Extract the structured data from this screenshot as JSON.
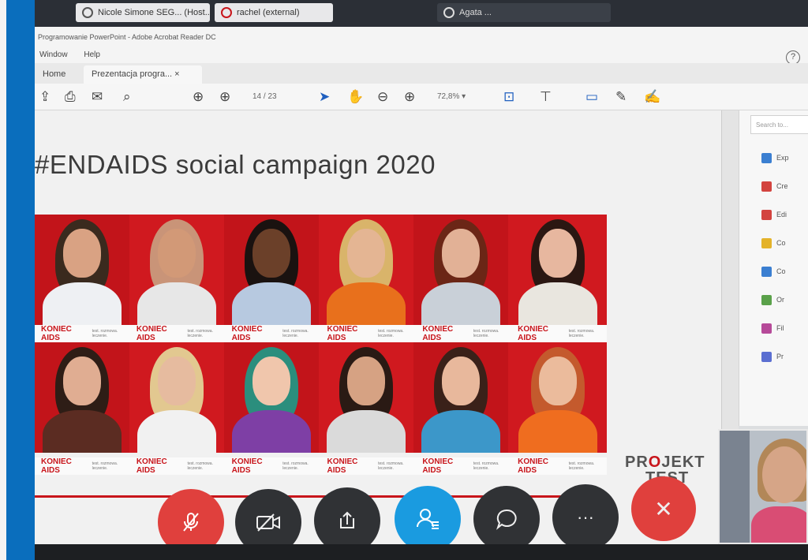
{
  "taskbar": {
    "tab1": "Nicole Simone SEG... (Host...)",
    "tab2": "rachel (external)",
    "tab3": "Agata ..."
  },
  "window": {
    "title": "Programowanie PowerPoint - Adobe Acrobat Reader DC",
    "menu": [
      "Window",
      "Help"
    ],
    "tabs": [
      "Home",
      "Prezentacja progra... ×"
    ],
    "page_indicator": "14 / 23",
    "zoom": "72,8%  ▾"
  },
  "slide": {
    "title": "#ENDAIDS social campaign 2020",
    "logo_text": "KONIEC AIDS",
    "logo_sub": "test. rozmowa. leczenie.",
    "projekt_line1": "PROJEKT",
    "projekt_line2": "TEST",
    "row1": [
      {
        "hair": "#3a2a1e",
        "skin": "#d9a283",
        "shirt": "#eef0f3"
      },
      {
        "hair": "#c99478",
        "skin": "#d29977",
        "shirt": "#e7e7e7"
      },
      {
        "hair": "#1a1210",
        "skin": "#6b4029",
        "shirt": "#b7c9e0"
      },
      {
        "hair": "#d9b46a",
        "skin": "#e4b593",
        "shirt": "#e8701c"
      },
      {
        "hair": "#6b2616",
        "skin": "#e2b196",
        "shirt": "#c9d0d8"
      },
      {
        "hair": "#2b1712",
        "skin": "#e7b79f",
        "shirt": "#e9e6df"
      }
    ],
    "row2": [
      {
        "hair": "#2e1d16",
        "skin": "#e0ad92",
        "shirt": "#5b2c22"
      },
      {
        "hair": "#e2c890",
        "skin": "#e6bb9f",
        "shirt": "#f1f1f1"
      },
      {
        "hair": "#2b8e7d",
        "skin": "#f0c6ac",
        "shirt": "#7e3fa5"
      },
      {
        "hair": "#2a1a14",
        "skin": "#d6a283",
        "shirt": "#dadada"
      },
      {
        "hair": "#3a2119",
        "skin": "#e8b89c",
        "shirt": "#3c97c9"
      },
      {
        "hair": "#c45a2d",
        "skin": "#ebbb9c",
        "shirt": "#ef6d1f"
      }
    ]
  },
  "sidebar": {
    "search_placeholder": "Search to...",
    "items": [
      "Exp",
      "Cre",
      "Edi",
      "Co",
      "Co",
      "Or",
      "Fil",
      "Pr"
    ],
    "colors": [
      "#3b7fd1",
      "#d3443f",
      "#d3443f",
      "#e4b32a",
      "#3b7fd1",
      "#5aa14a",
      "#b64a99",
      "#5b6fd1"
    ]
  },
  "controls": {
    "mute": "mic-off-icon",
    "video": "video-off-icon",
    "share": "share-screen-icon",
    "participants": "participants-icon",
    "chat": "chat-icon",
    "more": "···",
    "end": "✕"
  }
}
